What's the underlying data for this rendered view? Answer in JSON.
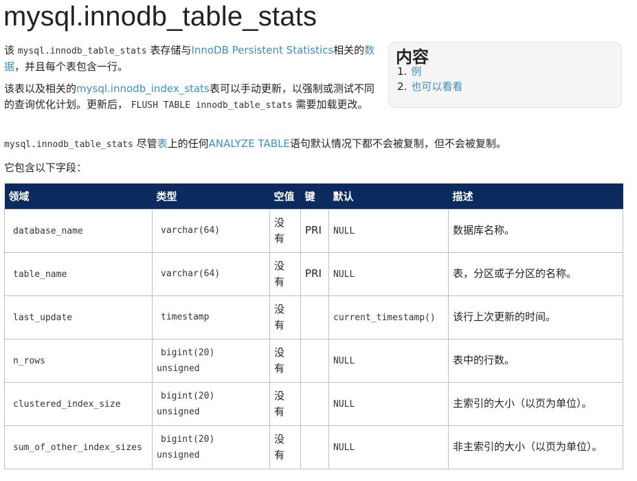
{
  "title": "mysql.innodb_table_stats",
  "p1": {
    "t1": "该 ",
    "code": "mysql.innodb_table_stats",
    "t2": " 表存储与",
    "link1": "InnoDB Persistent Statistics",
    "t3": "相关的",
    "link2": "数据",
    "t4": "，并且每个表包含一行。"
  },
  "p2": {
    "t1": "该表以及相关的",
    "link1": "mysql.innodb_index_stats",
    "t2": "表可以手动更新，以强制或测试不同的查询优化计划。更新后，",
    "code": "FLUSH TABLE innodb_table_stats",
    "t3": "需要加载更改。"
  },
  "p3": {
    "code": "mysql.innodb_table_stats",
    "t1": " 尽管",
    "link1": "表",
    "t2": "上的任何",
    "link2": "ANALYZE TABLE",
    "t3": "语句默认情况下都不会被复制，但不会被复制。"
  },
  "p4": "它包含以下字段：",
  "toc": {
    "title": "内容",
    "items": [
      {
        "num": "1.",
        "label": "例"
      },
      {
        "num": "2.",
        "label": "也可以看看"
      }
    ]
  },
  "table": {
    "headers": [
      "领域",
      "类型",
      "空值",
      "键",
      "默认",
      "描述"
    ],
    "rows": [
      {
        "field": "database_name",
        "type1": "varchar(64)",
        "type2": "",
        "null1": "没",
        "null2": "有",
        "key": "PRI",
        "default": "NULL",
        "desc": "数据库名称。"
      },
      {
        "field": "table_name",
        "type1": "varchar(64)",
        "type2": "",
        "null1": "没",
        "null2": "有",
        "key": "PRI",
        "default": "NULL",
        "desc": "表，分区或子分区的名称。"
      },
      {
        "field": "last_update",
        "type1": "timestamp",
        "type2": "",
        "null1": "没",
        "null2": "有",
        "key": "",
        "default": "current_timestamp()",
        "desc": "该行上次更新的时间。"
      },
      {
        "field": "n_rows",
        "type1": "bigint(20)",
        "type2": "unsigned",
        "null1": "没",
        "null2": "有",
        "key": "",
        "default": "NULL",
        "desc": "表中的行数。"
      },
      {
        "field": "clustered_index_size",
        "type1": "bigint(20)",
        "type2": "unsigned",
        "null1": "没",
        "null2": "有",
        "key": "",
        "default": "NULL",
        "desc": "主索引的大小（以页为单位）。"
      },
      {
        "field": "sum_of_other_index_sizes",
        "type1": "bigint(20)",
        "type2": "unsigned",
        "null1": "没",
        "null2": "有",
        "key": "",
        "default": "NULL",
        "desc": "非主索引的大小（以页为单位）。"
      }
    ]
  }
}
